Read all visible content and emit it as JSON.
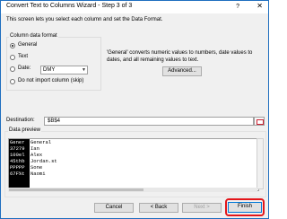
{
  "window": {
    "title": "Convert Text to Columns Wizard - Step 3 of 3",
    "help_label": "?",
    "close_label": "✕"
  },
  "intro": "This screen lets you select each column and set the Data Format.",
  "column_format": {
    "heading": "Column data format",
    "options": [
      {
        "label": "General",
        "selected": true
      },
      {
        "label": "Text",
        "selected": false
      },
      {
        "label": "Date:",
        "selected": false
      },
      {
        "label": "Do not import column (skip)",
        "selected": false
      }
    ],
    "date_value": "DMY"
  },
  "general_note": "'General' converts numeric values to numbers, date values to dates, and all remaining values to text.",
  "advanced_label": "Advanced...",
  "destination": {
    "label": "Destination:",
    "value": "$B$4"
  },
  "preview": {
    "heading": "Data preview",
    "headers": [
      "Gener",
      "General"
    ],
    "rows": [
      [
        "37279",
        "Ian"
      ],
      [
        "100el",
        "Alex"
      ],
      [
        "45thb",
        "Jordan.st"
      ],
      [
        "PPPPP",
        "Sone"
      ],
      [
        "67F%t",
        "Naomi"
      ]
    ]
  },
  "buttons": {
    "cancel": "Cancel",
    "back": "< Back",
    "next": "Next >",
    "finish": "Finish"
  },
  "colors": {
    "highlight": "#e3151a",
    "accent": "#1f6fbf"
  }
}
